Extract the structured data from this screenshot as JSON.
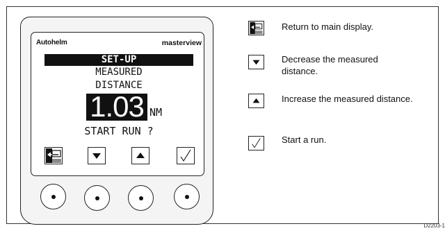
{
  "device": {
    "brand": "Autohelm",
    "model": "masterview",
    "screen": {
      "header": "SET-UP",
      "line1": "MEASURED",
      "line2": "DISTANCE",
      "value": "1.03",
      "unit": "NM",
      "prompt": "START RUN ?"
    },
    "soft_keys": [
      "return-icon",
      "arrow-down-icon",
      "arrow-up-icon",
      "check-icon"
    ],
    "hard_buttons": 4
  },
  "legend": [
    {
      "icon": "return-icon",
      "text": "Return to main display."
    },
    {
      "icon": "arrow-down-icon",
      "text": "Decrease the measured distance."
    },
    {
      "icon": "arrow-up-icon",
      "text": "Increase the measured distance."
    },
    {
      "icon": "check-icon",
      "text": "Start a run."
    }
  ],
  "figure_id": "D2203-1"
}
